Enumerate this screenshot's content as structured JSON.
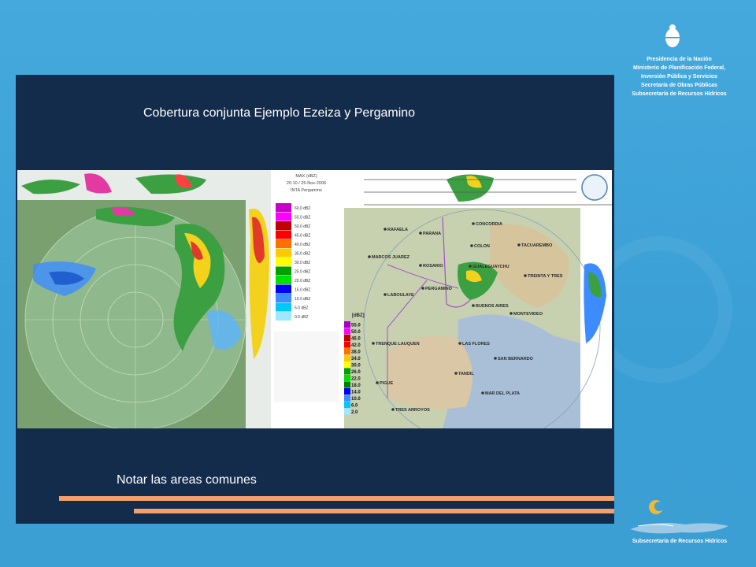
{
  "header": {
    "lines": [
      "Presidencia de la Nación",
      "Ministerio de Planificación Federal,",
      "Inversión Pública y Servicios",
      "Secretaría de Obras Públicas",
      "Subsecretaría de Recursos Hídricos"
    ]
  },
  "slide": {
    "title": "Cobertura conjunta Ejemplo Ezeiza y Pergamino",
    "note": "Notar las areas comunes"
  },
  "radar_left": {
    "legend_title": "MAX (dBZ)",
    "legend_date": "20:10 / 25-Nov-2006",
    "legend_site": "INTA Pergamino",
    "scale_labels": [
      "60.0 dBZ",
      "55.0 dBZ",
      "50.0 dBZ",
      "45.0 dBZ",
      "40.0 dBZ",
      "35.0 dBZ",
      "30.0 dBZ",
      "25.0 dBZ",
      "20.0 dBZ",
      "15.0 dBZ",
      "10.0 dBZ",
      "5.0 dBZ",
      "0.0 dBZ"
    ],
    "colors": [
      "#f0f0f0",
      "#c800c8",
      "#ff00ff",
      "#c00000",
      "#ff0000",
      "#ff7000",
      "#ffc800",
      "#ffff00",
      "#00a000",
      "#00e000",
      "#0000ff",
      "#3c8cff",
      "#00c8ff",
      "#a0e6ff"
    ]
  },
  "radar_right": {
    "unit": "[dBZ]",
    "scale": [
      "55.0",
      "50.0",
      "46.0",
      "42.0",
      "38.0",
      "34.0",
      "30.0",
      "26.0",
      "22.0",
      "18.0",
      "14.0",
      "10.0",
      "6.0",
      "2.0"
    ],
    "cities": [
      {
        "name": "RAFAELA"
      },
      {
        "name": "PARANA"
      },
      {
        "name": "CONCORDIA"
      },
      {
        "name": "TACUAREMBO"
      },
      {
        "name": "MARCOS JUAREZ"
      },
      {
        "name": "COLON"
      },
      {
        "name": "ROSARIO"
      },
      {
        "name": "GUALEGUAYCHU"
      },
      {
        "name": "TREINTA Y TRES"
      },
      {
        "name": "LABOULAYE"
      },
      {
        "name": "PERGAMINO"
      },
      {
        "name": "BUENOS AIRES"
      },
      {
        "name": "MONTEVIDEO"
      },
      {
        "name": "TRENQUE LAUQUEN"
      },
      {
        "name": "LAS FLORES"
      },
      {
        "name": "SAN BERNARDO"
      },
      {
        "name": "TANDIL"
      },
      {
        "name": "PIGUE"
      },
      {
        "name": "MAR DEL PLATA"
      },
      {
        "name": "TRES ARROYOS"
      }
    ]
  },
  "footer": {
    "subsecretaria": "Subsecretaría de Recursos Hídricos"
  }
}
